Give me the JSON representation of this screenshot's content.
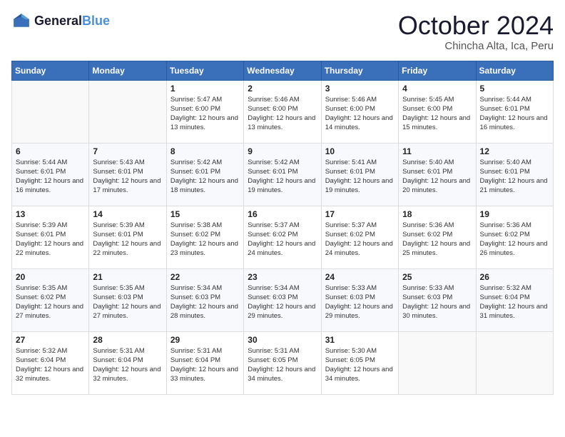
{
  "header": {
    "logo_general": "General",
    "logo_blue": "Blue",
    "month": "October 2024",
    "location": "Chincha Alta, Ica, Peru"
  },
  "weekdays": [
    "Sunday",
    "Monday",
    "Tuesday",
    "Wednesday",
    "Thursday",
    "Friday",
    "Saturday"
  ],
  "weeks": [
    [
      {
        "day": "",
        "sunrise": "",
        "sunset": "",
        "daylight": ""
      },
      {
        "day": "",
        "sunrise": "",
        "sunset": "",
        "daylight": ""
      },
      {
        "day": "1",
        "sunrise": "Sunrise: 5:47 AM",
        "sunset": "Sunset: 6:00 PM",
        "daylight": "Daylight: 12 hours and 13 minutes."
      },
      {
        "day": "2",
        "sunrise": "Sunrise: 5:46 AM",
        "sunset": "Sunset: 6:00 PM",
        "daylight": "Daylight: 12 hours and 13 minutes."
      },
      {
        "day": "3",
        "sunrise": "Sunrise: 5:46 AM",
        "sunset": "Sunset: 6:00 PM",
        "daylight": "Daylight: 12 hours and 14 minutes."
      },
      {
        "day": "4",
        "sunrise": "Sunrise: 5:45 AM",
        "sunset": "Sunset: 6:00 PM",
        "daylight": "Daylight: 12 hours and 15 minutes."
      },
      {
        "day": "5",
        "sunrise": "Sunrise: 5:44 AM",
        "sunset": "Sunset: 6:01 PM",
        "daylight": "Daylight: 12 hours and 16 minutes."
      }
    ],
    [
      {
        "day": "6",
        "sunrise": "Sunrise: 5:44 AM",
        "sunset": "Sunset: 6:01 PM",
        "daylight": "Daylight: 12 hours and 16 minutes."
      },
      {
        "day": "7",
        "sunrise": "Sunrise: 5:43 AM",
        "sunset": "Sunset: 6:01 PM",
        "daylight": "Daylight: 12 hours and 17 minutes."
      },
      {
        "day": "8",
        "sunrise": "Sunrise: 5:42 AM",
        "sunset": "Sunset: 6:01 PM",
        "daylight": "Daylight: 12 hours and 18 minutes."
      },
      {
        "day": "9",
        "sunrise": "Sunrise: 5:42 AM",
        "sunset": "Sunset: 6:01 PM",
        "daylight": "Daylight: 12 hours and 19 minutes."
      },
      {
        "day": "10",
        "sunrise": "Sunrise: 5:41 AM",
        "sunset": "Sunset: 6:01 PM",
        "daylight": "Daylight: 12 hours and 19 minutes."
      },
      {
        "day": "11",
        "sunrise": "Sunrise: 5:40 AM",
        "sunset": "Sunset: 6:01 PM",
        "daylight": "Daylight: 12 hours and 20 minutes."
      },
      {
        "day": "12",
        "sunrise": "Sunrise: 5:40 AM",
        "sunset": "Sunset: 6:01 PM",
        "daylight": "Daylight: 12 hours and 21 minutes."
      }
    ],
    [
      {
        "day": "13",
        "sunrise": "Sunrise: 5:39 AM",
        "sunset": "Sunset: 6:01 PM",
        "daylight": "Daylight: 12 hours and 22 minutes."
      },
      {
        "day": "14",
        "sunrise": "Sunrise: 5:39 AM",
        "sunset": "Sunset: 6:01 PM",
        "daylight": "Daylight: 12 hours and 22 minutes."
      },
      {
        "day": "15",
        "sunrise": "Sunrise: 5:38 AM",
        "sunset": "Sunset: 6:02 PM",
        "daylight": "Daylight: 12 hours and 23 minutes."
      },
      {
        "day": "16",
        "sunrise": "Sunrise: 5:37 AM",
        "sunset": "Sunset: 6:02 PM",
        "daylight": "Daylight: 12 hours and 24 minutes."
      },
      {
        "day": "17",
        "sunrise": "Sunrise: 5:37 AM",
        "sunset": "Sunset: 6:02 PM",
        "daylight": "Daylight: 12 hours and 24 minutes."
      },
      {
        "day": "18",
        "sunrise": "Sunrise: 5:36 AM",
        "sunset": "Sunset: 6:02 PM",
        "daylight": "Daylight: 12 hours and 25 minutes."
      },
      {
        "day": "19",
        "sunrise": "Sunrise: 5:36 AM",
        "sunset": "Sunset: 6:02 PM",
        "daylight": "Daylight: 12 hours and 26 minutes."
      }
    ],
    [
      {
        "day": "20",
        "sunrise": "Sunrise: 5:35 AM",
        "sunset": "Sunset: 6:02 PM",
        "daylight": "Daylight: 12 hours and 27 minutes."
      },
      {
        "day": "21",
        "sunrise": "Sunrise: 5:35 AM",
        "sunset": "Sunset: 6:03 PM",
        "daylight": "Daylight: 12 hours and 27 minutes."
      },
      {
        "day": "22",
        "sunrise": "Sunrise: 5:34 AM",
        "sunset": "Sunset: 6:03 PM",
        "daylight": "Daylight: 12 hours and 28 minutes."
      },
      {
        "day": "23",
        "sunrise": "Sunrise: 5:34 AM",
        "sunset": "Sunset: 6:03 PM",
        "daylight": "Daylight: 12 hours and 29 minutes."
      },
      {
        "day": "24",
        "sunrise": "Sunrise: 5:33 AM",
        "sunset": "Sunset: 6:03 PM",
        "daylight": "Daylight: 12 hours and 29 minutes."
      },
      {
        "day": "25",
        "sunrise": "Sunrise: 5:33 AM",
        "sunset": "Sunset: 6:03 PM",
        "daylight": "Daylight: 12 hours and 30 minutes."
      },
      {
        "day": "26",
        "sunrise": "Sunrise: 5:32 AM",
        "sunset": "Sunset: 6:04 PM",
        "daylight": "Daylight: 12 hours and 31 minutes."
      }
    ],
    [
      {
        "day": "27",
        "sunrise": "Sunrise: 5:32 AM",
        "sunset": "Sunset: 6:04 PM",
        "daylight": "Daylight: 12 hours and 32 minutes."
      },
      {
        "day": "28",
        "sunrise": "Sunrise: 5:31 AM",
        "sunset": "Sunset: 6:04 PM",
        "daylight": "Daylight: 12 hours and 32 minutes."
      },
      {
        "day": "29",
        "sunrise": "Sunrise: 5:31 AM",
        "sunset": "Sunset: 6:04 PM",
        "daylight": "Daylight: 12 hours and 33 minutes."
      },
      {
        "day": "30",
        "sunrise": "Sunrise: 5:31 AM",
        "sunset": "Sunset: 6:05 PM",
        "daylight": "Daylight: 12 hours and 34 minutes."
      },
      {
        "day": "31",
        "sunrise": "Sunrise: 5:30 AM",
        "sunset": "Sunset: 6:05 PM",
        "daylight": "Daylight: 12 hours and 34 minutes."
      },
      {
        "day": "",
        "sunrise": "",
        "sunset": "",
        "daylight": ""
      },
      {
        "day": "",
        "sunrise": "",
        "sunset": "",
        "daylight": ""
      }
    ]
  ]
}
